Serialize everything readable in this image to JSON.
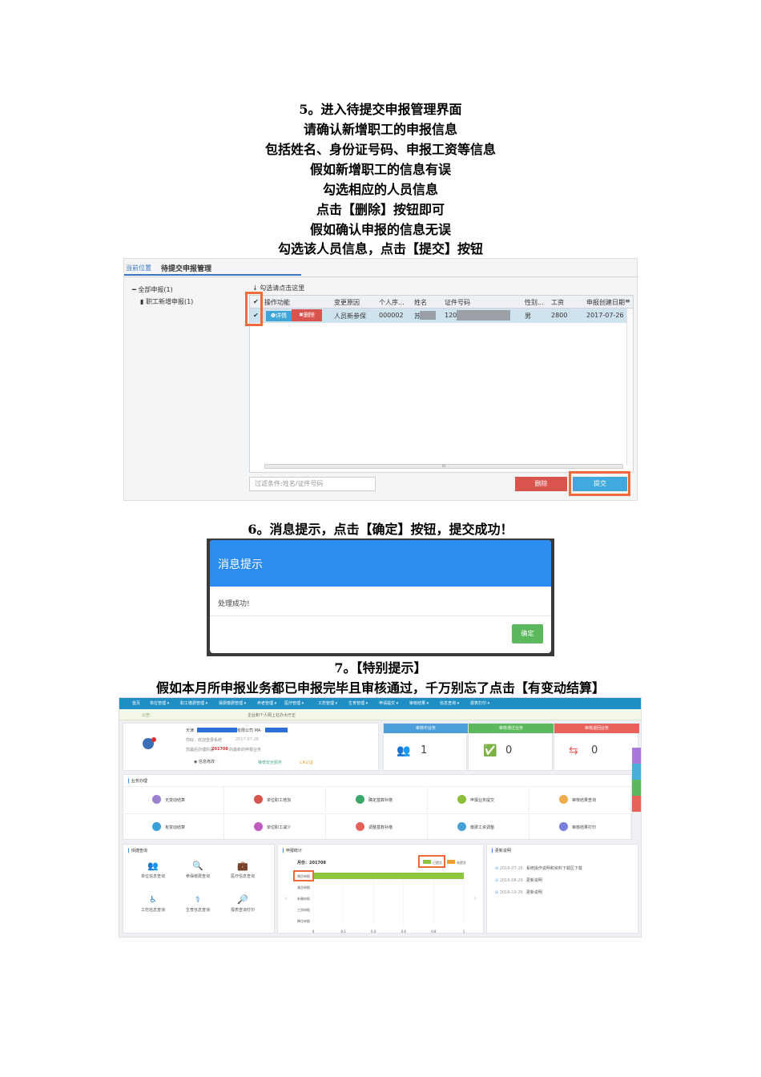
{
  "captions": {
    "step5": [
      "5。进入待提交申报管理界面",
      "请确认新增职工的申报信息",
      "包括姓名、身份证号码、申报工资等信息",
      "假如新增职工的信息有误",
      "勾选相应的人员信息",
      "点击【删除】按钮即可",
      "假如确认申报的信息无误",
      "勾选该人员信息，点击【提交】按钮"
    ],
    "step6": "6。消息提示，点击【确定】按钮，提交成功！",
    "step7_title": "7。【特别提示】",
    "step7_text": "假如本月所申报业务都已申报完毕且审核通过，千万别忘了点击【有变动结算】"
  },
  "screen1": {
    "breadcrumb_label": "当前位置",
    "page_title": "待提交申报管理",
    "tree": {
      "root": "全部申报(1)",
      "child": "职工新增申报(1)"
    },
    "hint": "勾选请点击这里",
    "columns": [
      "操作功能",
      "变更原因",
      "个人序...",
      "姓名",
      "证件号码",
      "性别...",
      "工资",
      "申报创建日期"
    ],
    "row": {
      "detail": "详情",
      "delete": "删除",
      "reason": "人员新参保",
      "seq": "000002",
      "name": "苏",
      "id": "120",
      "gender": "男",
      "salary": "2800",
      "date": "2017-07-26"
    },
    "filter_placeholder": "过滤条件:姓名/证件号码",
    "delete_button": "删除",
    "submit_button": "提交",
    "scroll_mark": "III"
  },
  "screen2": {
    "title": "消息提示",
    "message": "处理成功!",
    "ok_button": "确定"
  },
  "screen3": {
    "nav": [
      "首页",
      "单位管理 ▾",
      "职工缴费管理 ▾",
      "保费缴费管理 ▾",
      "养老管理 ▾",
      "医疗管理 ▾",
      "工伤管理 ▾",
      "生育管理 ▾",
      "申请提交 ▾",
      "审核结果 ▾",
      "信息查询 ▾",
      "报表打印 ▾"
    ],
    "subbar": {
      "left": "公告：",
      "center": "企业和个人网上社办大厅正"
    },
    "profile": {
      "l1": "天津",
      "l1b": "有限公司 MA",
      "l2": "你好，欢迎登录系统",
      "l2b": "2017-07-26",
      "l3a": "您最后办理的是",
      "l3b": "201708",
      "l3c": "的最新的申报业务",
      "l4a": "信息修改",
      "l4b": "推荐安全服务",
      "l4c": "CA认证"
    },
    "stats": [
      {
        "head": "审核中业务",
        "value": "1",
        "color": "#4a9fd9"
      },
      {
        "head": "审核通过业务",
        "value": "0",
        "color": "#5cb85c"
      },
      {
        "head": "审核退回业务",
        "value": "0",
        "color": "#e8625c"
      }
    ],
    "business_title": "业务办理",
    "business": [
      {
        "label": "无变动结算",
        "color": "#9b7fd1"
      },
      {
        "label": "单位职工增加",
        "color": "#d9534f"
      },
      {
        "label": "确定基数补缴",
        "color": "#3aa86b"
      },
      {
        "label": "申报业务提交",
        "color": "#8bbf3c"
      },
      {
        "label": "审核结果查询",
        "color": "#f0ad4e"
      },
      {
        "label": "有变动结算",
        "color": "#3a9fd9"
      },
      {
        "label": "单位职工减少",
        "color": "#c05cc0"
      },
      {
        "label": "调整基数补缴",
        "color": "#e8625c"
      },
      {
        "label": "缴费工资调整",
        "color": "#4a9fd9"
      },
      {
        "label": "审核结果打印",
        "color": "#7a7fd9"
      }
    ],
    "quick_title": "快捷查询",
    "quick": [
      "单位信息查询",
      "参保缴费查询",
      "医疗信息查询",
      "工伤信息查询",
      "生育信息查询",
      "报表查询打印"
    ],
    "stat_title": "申报统计",
    "month_label": "月份：201708",
    "legend": [
      "已提交",
      "未提交"
    ],
    "chart_data": {
      "type": "bar",
      "categories": [
        "增员申报",
        "减员申报",
        "补缴申报",
        "工资申报",
        "降位申报"
      ],
      "series": [
        {
          "name": "已提交",
          "values": [
            1,
            0,
            0,
            0,
            0
          ]
        }
      ],
      "xlim": [
        0,
        1
      ],
      "xticks": [
        "0",
        "0.2",
        "0.4",
        "0.6",
        "0.8",
        "1"
      ]
    },
    "update_title": "更新说明",
    "updates": [
      {
        "date": "2016-07-26",
        "text": "系统操作说明和资料下载区下载"
      },
      {
        "date": "2016-08-29",
        "text": "更新说明"
      },
      {
        "date": "2016-10-26",
        "text": "更新说明"
      }
    ]
  }
}
